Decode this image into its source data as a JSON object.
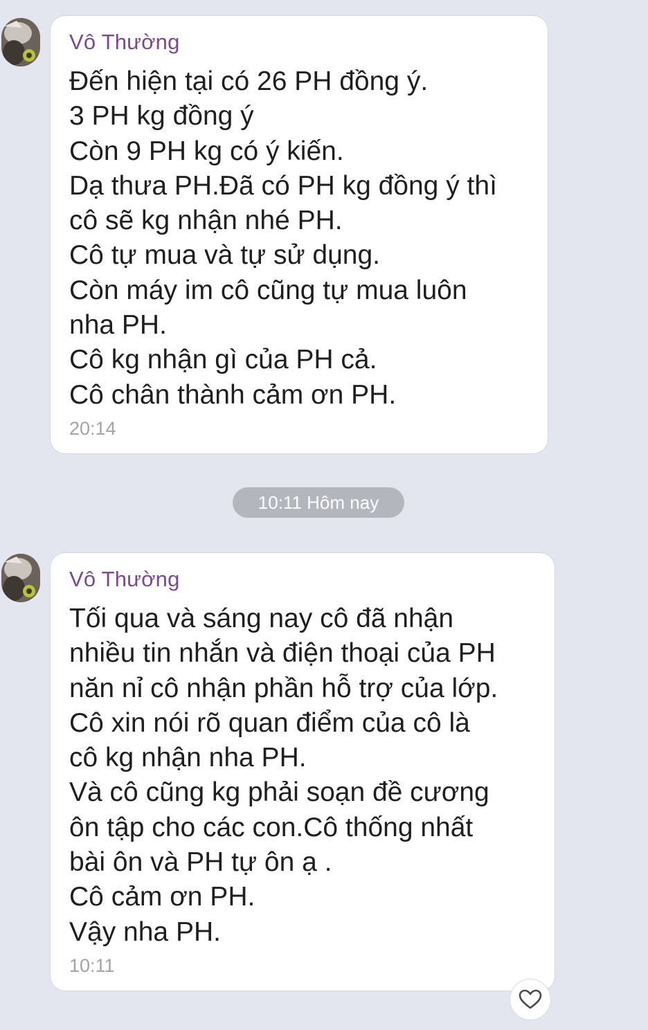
{
  "messages": [
    {
      "sender": "Vô Thường",
      "lines": [
        "Đến hiện tại có 26 PH đồng ý.",
        "3 PH kg đồng ý",
        "Còn 9 PH kg có ý kiến.",
        "Dạ thưa PH.Đã có PH kg đồng ý thì",
        "cô sẽ kg nhận nhé PH.",
        "Cô tự mua và tự sử dụng.",
        "Còn máy im cô cũng tự mua luôn",
        "nha PH.",
        "Cô kg nhận gì của PH cả.",
        "Cô chân thành cảm ơn PH."
      ],
      "time": "20:14"
    },
    {
      "sender": "Vô Thường",
      "lines": [
        "Tối qua và sáng nay cô đã nhận",
        "nhiều tin nhắn và điện thoại của PH",
        "năn nỉ cô nhận phần hỗ trợ của lớp.",
        "Cô xin nói rõ quan điểm của cô là",
        "cô kg nhận nha PH.",
        "Và cô cũng kg phải soạn đề cương",
        "ôn tập cho các con.Cô thống nhất",
        "bài ôn và PH tự ôn ạ .",
        "Cô cảm ơn PH.",
        "Vậy nha PH."
      ],
      "time": "10:11"
    }
  ],
  "date_divider": "10:11 Hôm nay",
  "icons": {
    "avatar": "avatar-photo",
    "reaction": "heart-outline-icon"
  },
  "colors": {
    "background": "#e3e6ee",
    "sender_name": "#7a4a8c",
    "bubble": "#ffffff",
    "divider_pill": "#b3b6bd"
  }
}
